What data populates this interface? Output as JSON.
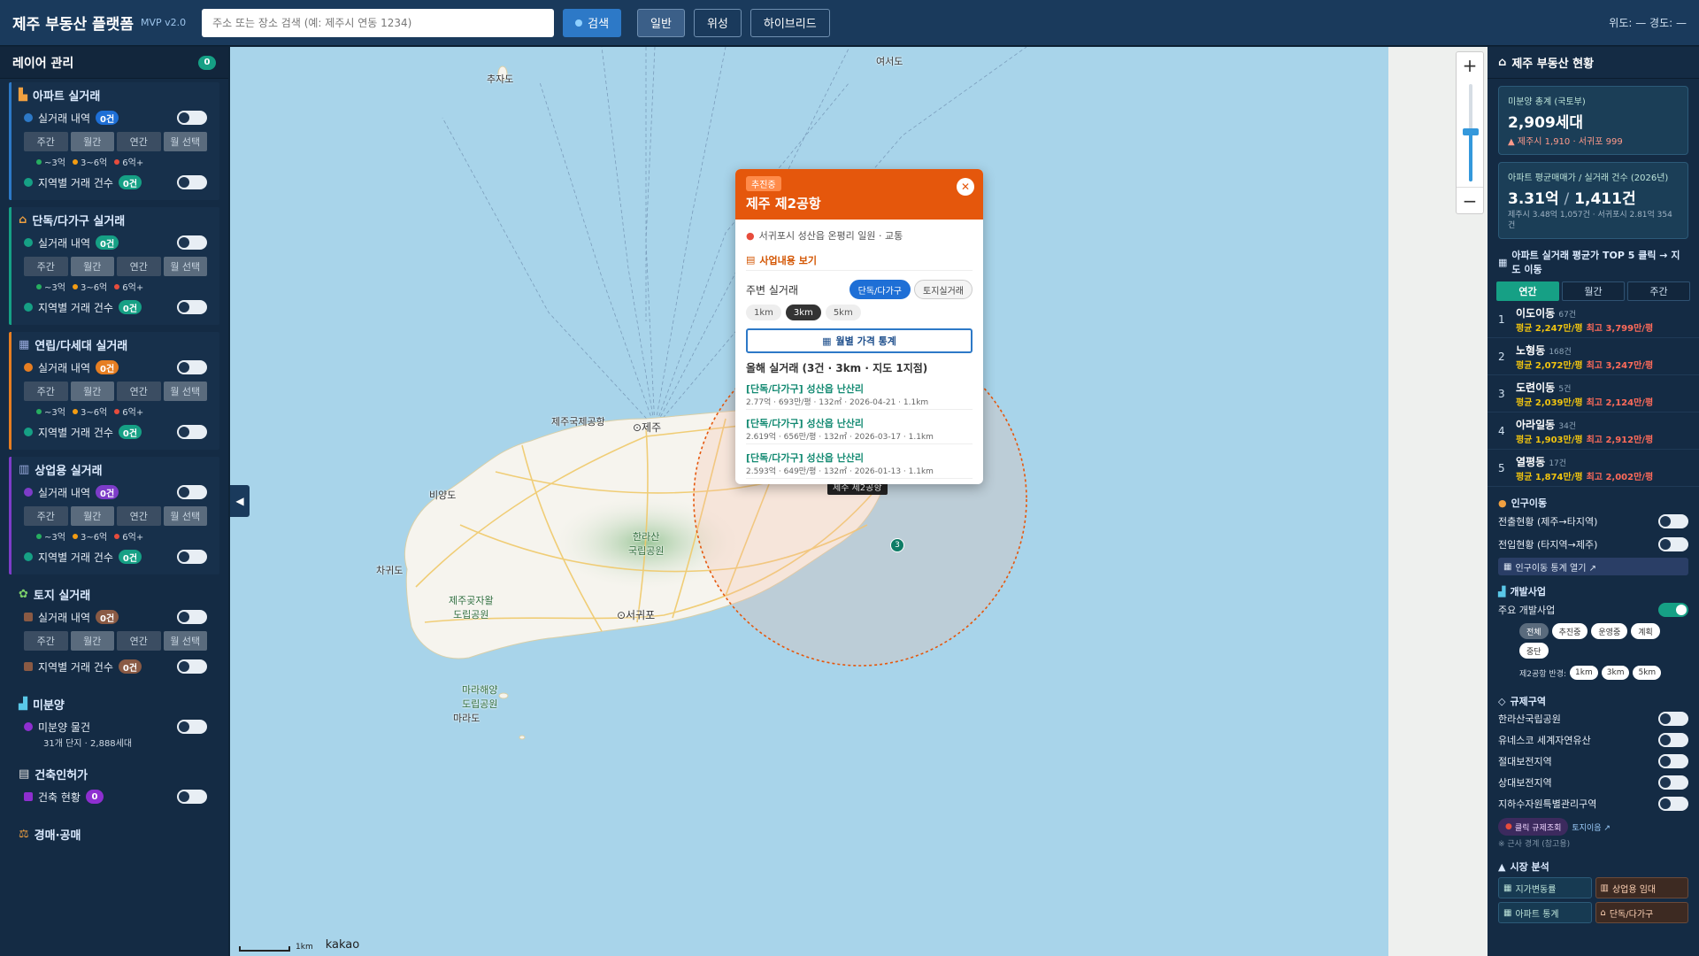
{
  "header": {
    "title": "제주 부동산 플랫폼",
    "version": "MVP v2.0",
    "search_placeholder": "주소 또는 장소 검색 (예: 제주시 연동 1234)",
    "search_button": "검색",
    "map_types": [
      "일반",
      "위성",
      "하이브리드"
    ],
    "active_map_type": "일반",
    "coords": "위도: — 경도: —"
  },
  "left": {
    "title": "레이어 관리",
    "count": "0",
    "periods": [
      "주간",
      "월간",
      "연간",
      "월 선택"
    ],
    "legend": [
      "~3억",
      "3~6억",
      "6억+"
    ],
    "sections": [
      {
        "title": "아파트 실거래",
        "rows": [
          {
            "label": "실거래 내역",
            "badge": "0건"
          },
          {
            "label": "지역별 거래 건수",
            "badge": "0건"
          }
        ]
      },
      {
        "title": "단독/다가구 실거래",
        "rows": [
          {
            "label": "실거래 내역",
            "badge": "0건"
          },
          {
            "label": "지역별 거래 건수",
            "badge": "0건"
          }
        ]
      },
      {
        "title": "연립/다세대 실거래",
        "rows": [
          {
            "label": "실거래 내역",
            "badge": "0건"
          },
          {
            "label": "지역별 거래 건수",
            "badge": "0건"
          }
        ]
      },
      {
        "title": "상업용 실거래",
        "rows": [
          {
            "label": "실거래 내역",
            "badge": "0건"
          },
          {
            "label": "지역별 거래 건수",
            "badge": "0건"
          }
        ]
      },
      {
        "title": "토지 실거래",
        "rows": [
          {
            "label": "실거래 내역",
            "badge": "0건"
          },
          {
            "label": "지역별 거래 건수",
            "badge": "0건"
          }
        ]
      }
    ],
    "unsold": {
      "title": "미분양",
      "label": "미분양 물건",
      "sub": "31개 단지 · 2,888세대"
    },
    "permit": {
      "title": "건축인허가",
      "label": "건축 현황",
      "badge": "0"
    },
    "auction": {
      "title": "경매·공매"
    }
  },
  "map": {
    "labels": {
      "chujado": "추자도",
      "yeoseo": "여서도",
      "airport": "제주국제공항",
      "jeju": "⊙제주",
      "biyangdo": "비양도",
      "chagwido": "차귀도",
      "seogwipo": "⊙서귀포",
      "marado": "마라도",
      "hallasan": "한라산\n국립공원",
      "gotjawal": "제주곶자왈\n도립공원",
      "marine": "마라해양\n도립공원"
    },
    "airport2_label": "제주 제2공항",
    "cluster": "3",
    "scale": "1km",
    "brand": "kakao"
  },
  "popup": {
    "tag": "추진중",
    "title": "제주 제2공항",
    "address": "서귀포시 성산읍 온평리 일원 · 교통",
    "link": "사업내용 보기",
    "nearby_label": "주변 실거래",
    "chips": [
      "단독/다가구",
      "토지실거래"
    ],
    "radii": [
      "1km",
      "3km",
      "5km"
    ],
    "stats_button": "월별 가격 통계",
    "year_title": "올해 실거래 (3건 · 3km · 지도 1지점)",
    "deals": [
      {
        "name": "[단독/다가구] 성산읍 난산리",
        "detail": "2.77억 · 693만/평 · 132㎡ · 2026-04-21 · 1.1km"
      },
      {
        "name": "[단독/다가구] 성산읍 난산리",
        "detail": "2.619억 · 656만/평 · 132㎡ · 2026-03-17 · 1.1km"
      },
      {
        "name": "[단독/다가구] 성산읍 난산리",
        "detail": "2.593억 · 649만/평 · 132㎡ · 2026-01-13 · 1.1km"
      }
    ]
  },
  "right": {
    "title": "제주 부동산 현황",
    "unsold_card": {
      "label": "미분양 총계 (국토부)",
      "value": "2,909세대",
      "sub": "▲ 제주시 1,910 · 서귀포 999"
    },
    "apt_card": {
      "label": "아파트 평균매매가 / 실거래 건수 (2026년)",
      "value1": "3.31억",
      "sep": "/",
      "value2": "1,411건",
      "sub": "제주시 3.48억 1,057건 · 서귀포시 2.81억 354건"
    },
    "top5_title": "아파트 실거래 평균가 TOP 5 클릭 → 지도 이동",
    "top5_tabs": [
      "연간",
      "월간",
      "주간"
    ],
    "top5": [
      {
        "rank": "1",
        "name": "이도이동",
        "count": "67건",
        "avg": "평균 2,247만/평",
        "max": "최고 3,799만/평"
      },
      {
        "rank": "2",
        "name": "노형동",
        "count": "168건",
        "avg": "평균 2,072만/평",
        "max": "최고 3,247만/평"
      },
      {
        "rank": "3",
        "name": "도련이동",
        "count": "5건",
        "avg": "평균 2,039만/평",
        "max": "최고 2,124만/평"
      },
      {
        "rank": "4",
        "name": "아라일동",
        "count": "34건",
        "avg": "평균 1,903만/평",
        "max": "최고 2,912만/평"
      },
      {
        "rank": "5",
        "name": "열평동",
        "count": "17건",
        "avg": "평균 1,874만/평",
        "max": "최고 2,002만/평"
      }
    ],
    "population": {
      "title": "인구이동",
      "rows": [
        "전출현황 (제주→타지역)",
        "전입현황 (타지역→제주)"
      ],
      "link": "인구이동 통계 열기 ↗"
    },
    "dev": {
      "title": "개발사업",
      "row": "주요 개발사업",
      "filters": [
        "전체",
        "추진중",
        "운영중",
        "계획",
        "중단"
      ],
      "radius_label": "제2공항 반경:",
      "radii": [
        "1km",
        "3km",
        "5km"
      ]
    },
    "zones": {
      "title": "규제구역",
      "rows": [
        "한라산국립공원",
        "유네스코 세계자연유산",
        "절대보전지역",
        "상대보전지역",
        "지하수자원특별관리구역"
      ],
      "pill": "클릭 규제조회",
      "link": "토지이음 ↗",
      "note": "※ 근사 경계 (참고용)"
    },
    "market": {
      "title": "시장 분석",
      "items": [
        "지가변동률",
        "상업용 임대",
        "아파트 통계",
        "단독/다가구"
      ]
    }
  }
}
